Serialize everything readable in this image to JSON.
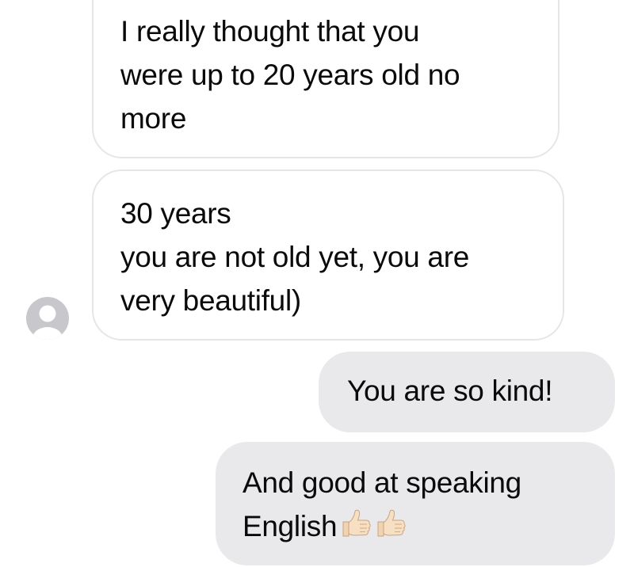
{
  "conversation": {
    "messages": [
      {
        "direction": "incoming",
        "lines": [
          "I really thought that you",
          "were up to 20 years old no",
          "more"
        ]
      },
      {
        "direction": "incoming",
        "lines": [
          "30 years",
          "you are not old yet, you are",
          "very beautiful)"
        ]
      },
      {
        "direction": "outgoing",
        "lines": [
          "You are so kind!"
        ]
      },
      {
        "direction": "outgoing",
        "lines": [
          "And good at speaking",
          "English"
        ],
        "trailing_icons": [
          "thumbs-up-icon",
          "thumbs-up-icon"
        ]
      }
    ],
    "sender_avatar": "default-avatar-icon"
  },
  "colors": {
    "incoming_bubble_bg": "#ffffff",
    "incoming_bubble_border": "#e6e6e9",
    "outgoing_bubble_bg": "#e9e9eb",
    "text": "#0a0a0a",
    "avatar": "#c7c7cc"
  }
}
